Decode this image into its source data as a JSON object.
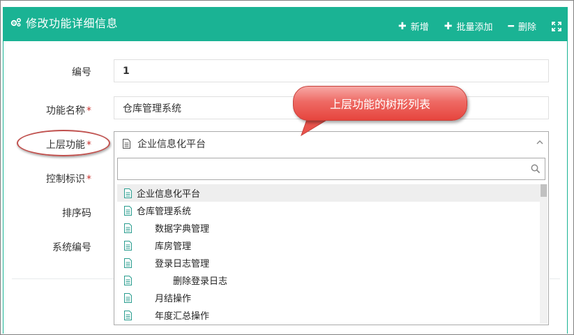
{
  "header": {
    "title": "修改功能详细信息",
    "tools": {
      "add_label": "新增",
      "batch_add_label": "批量添加",
      "delete_label": "删除"
    }
  },
  "form": {
    "id_label": "编号",
    "id_value": "1",
    "name_label": "功能名称",
    "name_value": "仓库管理系统",
    "parent_label": "上层功能",
    "control_label": "控制标识",
    "sort_label": "排序码",
    "system_label": "系统编号",
    "required_mark": "*"
  },
  "dropdown": {
    "selected": "企业信息化平台",
    "search_placeholder": "",
    "items": [
      {
        "label": "企业信息化平台",
        "indent": 0
      },
      {
        "label": "仓库管理系统",
        "indent": 0
      },
      {
        "label": "数据字典管理",
        "indent": 1
      },
      {
        "label": "库房管理",
        "indent": 1
      },
      {
        "label": "登录日志管理",
        "indent": 1
      },
      {
        "label": "删除登录日志",
        "indent": 2
      },
      {
        "label": "月结操作",
        "indent": 1
      },
      {
        "label": "年度汇总操作",
        "indent": 1
      }
    ]
  },
  "annotation": {
    "callout_text": "上层功能的树形列表"
  },
  "colors": {
    "accent": "#1ab394",
    "required": "#c9302c",
    "callout": "#e6453e"
  }
}
